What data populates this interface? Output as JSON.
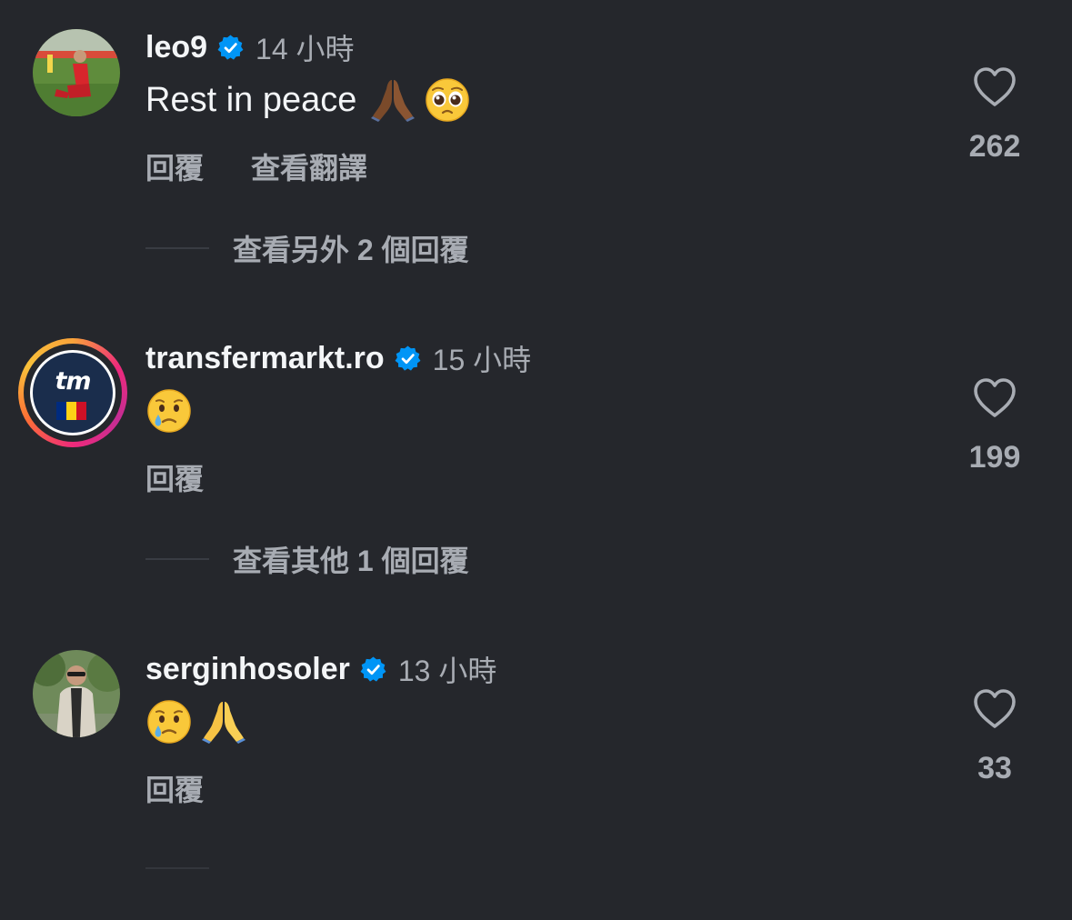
{
  "comments": [
    {
      "username": "leo9",
      "time": "14 小時",
      "text": "Rest in peace",
      "emojis": [
        "folded-hands-dark",
        "pleading-face"
      ],
      "actions": [
        "回覆",
        "查看翻譯"
      ],
      "likes": "262",
      "more_replies": "查看另外 2 個回覆"
    },
    {
      "username": "transfermarkt.ro",
      "time": "15 小時",
      "text": "",
      "emojis": [
        "crying-face"
      ],
      "actions": [
        "回覆"
      ],
      "likes": "199",
      "more_replies": "查看其他 1 個回覆"
    },
    {
      "username": "serginhosoler",
      "time": "13 小時",
      "text": "",
      "emojis": [
        "crying-face",
        "folded-hands"
      ],
      "actions": [
        "回覆"
      ],
      "likes": "33",
      "more_replies": ""
    }
  ],
  "avatar_logo_text": "tm",
  "colors": {
    "background": "#25272c",
    "verified": "#0095f6",
    "secondary_text": "#a8acb3",
    "primary_text": "#f3f5f7"
  }
}
